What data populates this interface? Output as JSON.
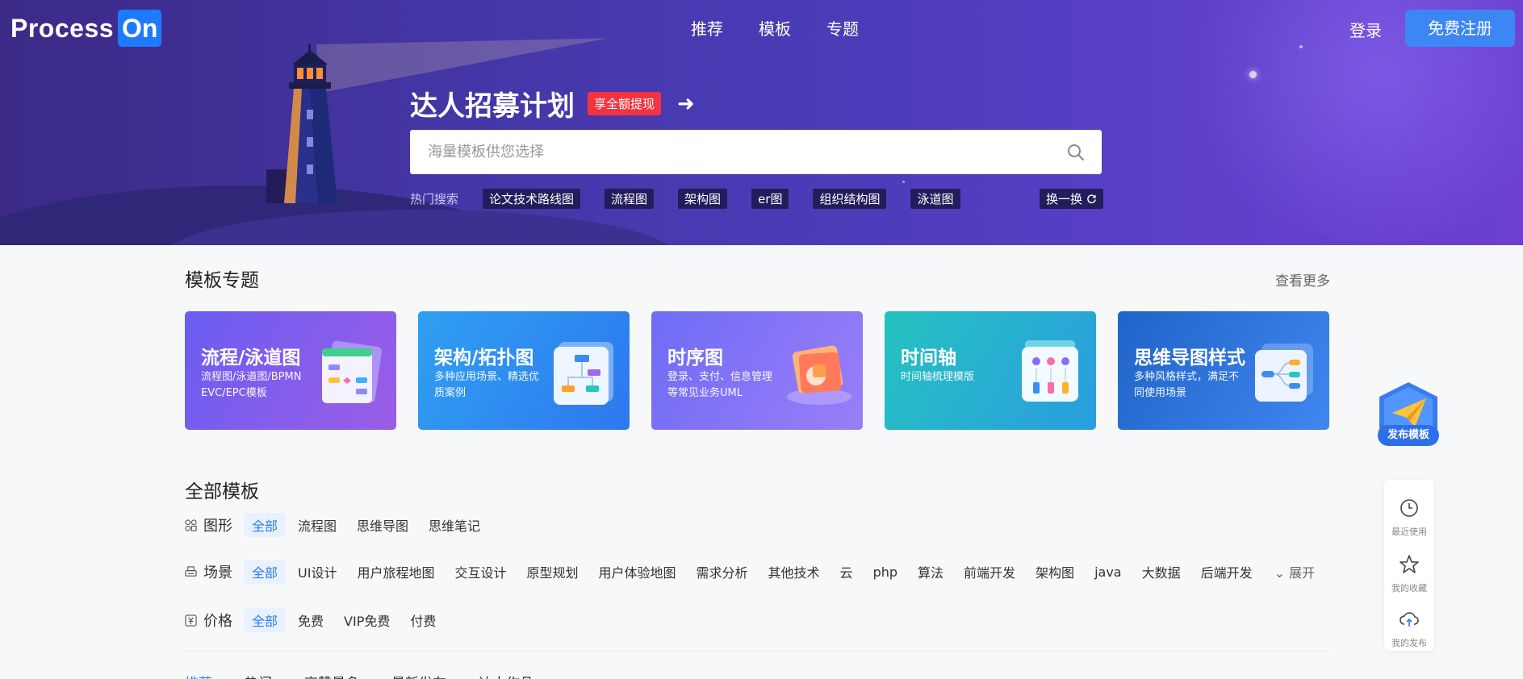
{
  "brand": {
    "logo_text": "Process",
    "logo_on": "On"
  },
  "nav": {
    "items": [
      "推荐",
      "模板",
      "专题"
    ]
  },
  "auth": {
    "login": "登录",
    "register": "免费注册"
  },
  "banner": {
    "title": "达人招募计划",
    "badge": "享全额提现",
    "arrow": "➜"
  },
  "search": {
    "placeholder": "海量模板供您选择",
    "value": ""
  },
  "hot_search": {
    "label": "热门搜索",
    "tags": [
      "论文技术路线图",
      "流程图",
      "架构图",
      "er图",
      "组织结构图",
      "泳道图"
    ],
    "refresh": "换一换"
  },
  "topics": {
    "title": "模板专题",
    "see_more": "查看更多",
    "cards": [
      {
        "title": "流程/泳道图",
        "desc": "流程图/泳道图/BPMN EVC/EPC模板",
        "color_a": "#6a5df2",
        "color_b": "#9b5de6"
      },
      {
        "title": "架构/拓扑图",
        "desc": "多种应用场景、精选优质案例",
        "color_a": "#2fa0f2",
        "color_b": "#2e78ef"
      },
      {
        "title": "时序图",
        "desc": "登录、支付、信息管理等常见业务UML",
        "color_a": "#6f6cf6",
        "color_b": "#9a7ef8"
      },
      {
        "title": "时间轴",
        "desc": "时间轴梳理模版",
        "color_a": "#25c2c0",
        "color_b": "#2a9de0"
      },
      {
        "title": "思维导图样式",
        "desc": "多种风格样式，满足不同使用场景",
        "color_a": "#2164c9",
        "color_b": "#3f86ee"
      }
    ]
  },
  "all_templates": {
    "title": "全部模板",
    "rows": [
      {
        "label": "图形",
        "icon": "grid-icon",
        "options": [
          "全部",
          "流程图",
          "思维导图",
          "思维笔记"
        ]
      },
      {
        "label": "场景",
        "icon": "printer-icon",
        "options": [
          "全部",
          "UI设计",
          "用户旅程地图",
          "交互设计",
          "原型规划",
          "用户体验地图",
          "需求分析",
          "其他技术",
          "云",
          "php",
          "算法",
          "前端开发",
          "架构图",
          "java",
          "大数据",
          "后端开发"
        ],
        "expand": "展开"
      },
      {
        "label": "价格",
        "icon": "price-icon",
        "options": [
          "全部",
          "免费",
          "VIP免费",
          "付费"
        ]
      }
    ],
    "bottom_tabs": [
      "推荐",
      "热门",
      "高赞最多",
      "最新发布",
      "达人作品"
    ]
  },
  "floating": {
    "publish": "发布模板",
    "side": [
      {
        "label": "最近使用",
        "icon": "clock-icon"
      },
      {
        "label": "我的收藏",
        "icon": "star-icon"
      },
      {
        "label": "我的发布",
        "icon": "cloud-upload-icon"
      }
    ]
  },
  "colors": {
    "accent": "#2c7cf6",
    "register_button": "#3d87f5",
    "badge_red": "#f5333f",
    "hero_base": "#4436a6"
  }
}
